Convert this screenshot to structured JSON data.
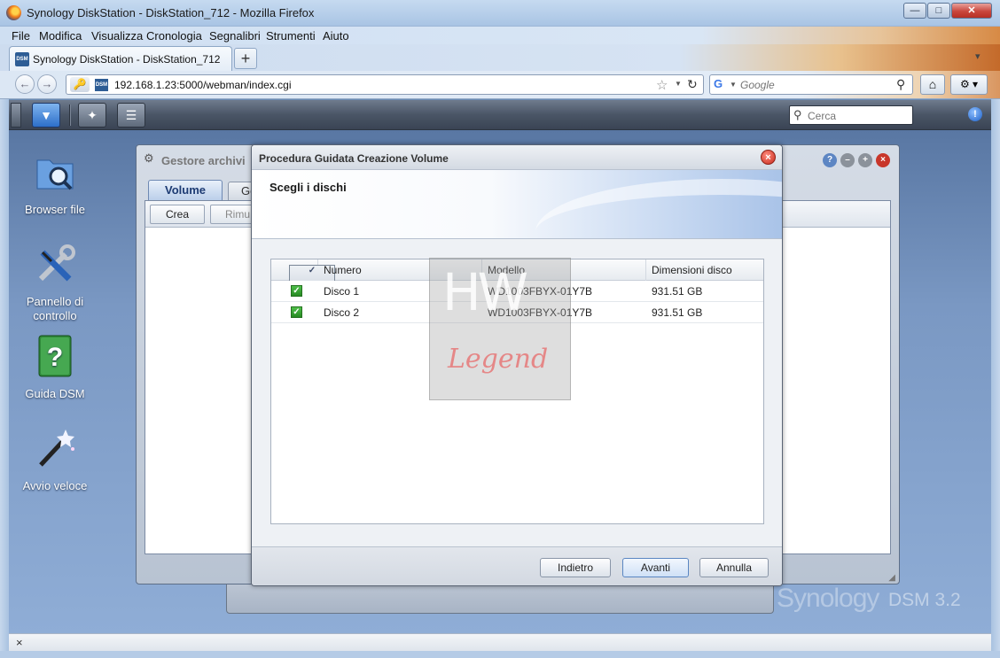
{
  "browser": {
    "window_title": "Synology DiskStation - DiskStation_712 - Mozilla Firefox",
    "menu": [
      "File",
      "Modifica",
      "Visualizza",
      "Cronologia",
      "Segnalibri",
      "Strumenti",
      "Aiuto"
    ],
    "tab_label": "Synology DiskStation - DiskStation_712",
    "favicon_text": "DSM",
    "url": "192.168.1.23:5000/webman/index.cgi",
    "search_placeholder": "Google",
    "icons": [
      "firefox-icon",
      "back-arrow-icon",
      "forward-arrow-icon",
      "key-icon",
      "star-icon",
      "reload-icon",
      "google-icon",
      "magnifier-icon",
      "home-icon",
      "addon-icon"
    ]
  },
  "dsm": {
    "search_placeholder": "Cerca",
    "taskbar_icons": [
      "main-menu-icon",
      "quick-start-wizard-icon",
      "storage-manager-icon",
      "notification-icon"
    ],
    "desktop_icons": [
      {
        "label": "Browser file",
        "icon": "folder-magnifier-icon"
      },
      {
        "label": "Pannello di controllo",
        "icon": "tools-icon"
      },
      {
        "label": "Guida DSM",
        "icon": "help-book-icon"
      },
      {
        "label": "Avvio veloce",
        "icon": "magic-wand-icon"
      }
    ],
    "logo_synology": "Synology",
    "logo_dsm": "DSM 3.2"
  },
  "storage_manager": {
    "title": "Gestore archivi",
    "tabs": [
      "Volume",
      "Ge"
    ],
    "toolbar": {
      "create": "Crea",
      "remove": "Rimu"
    }
  },
  "wizard": {
    "title": "Procedura Guidata Creazione Volume",
    "subtitle": "Scegli i dischi",
    "columns": [
      "Numero",
      "Modello",
      "Dimensioni disco"
    ],
    "rows": [
      {
        "checked": true,
        "number": "Disco 1",
        "model": "WD1003FBYX-01Y7B",
        "size": "931.51 GB"
      },
      {
        "checked": true,
        "number": "Disco 2",
        "model": "WD1003FBYX-01Y7B",
        "size": "931.51 GB"
      }
    ],
    "buttons": {
      "back": "Indietro",
      "next": "Avanti",
      "cancel": "Annulla"
    }
  },
  "watermark": {
    "top": "HW",
    "bottom": "Legend"
  },
  "statusbar": {
    "close_glyph": "×"
  }
}
